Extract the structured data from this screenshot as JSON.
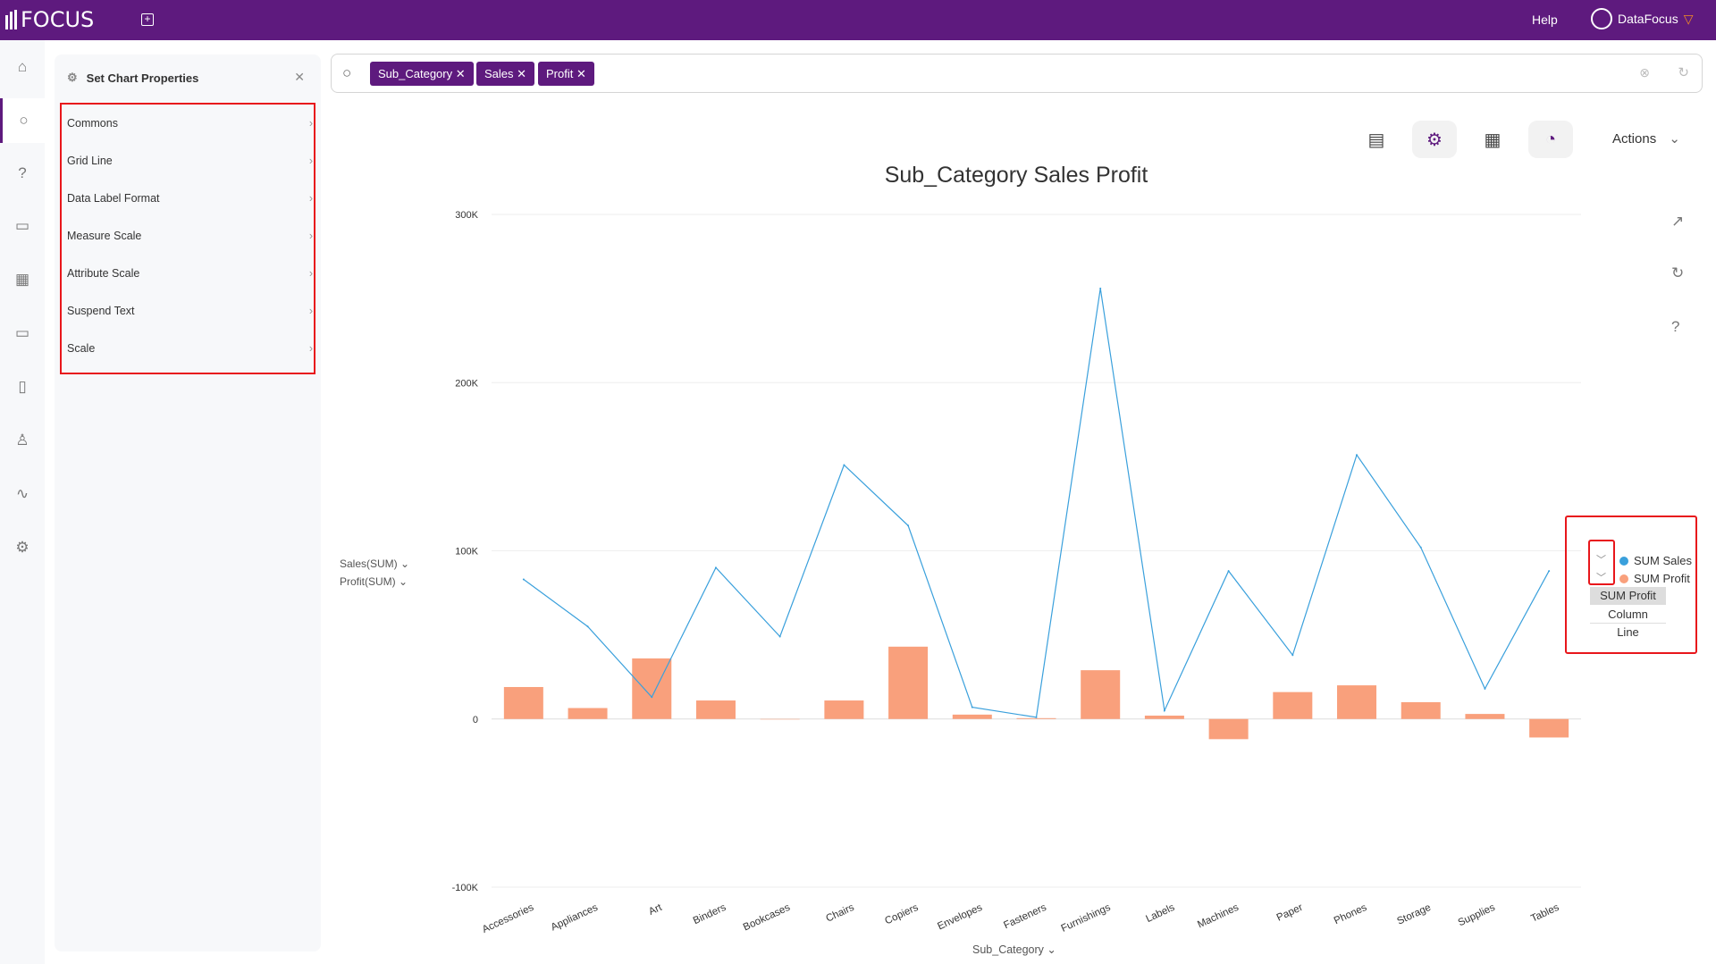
{
  "app": {
    "logo": "FOCUS",
    "help": "Help",
    "user": "DataFocus"
  },
  "nav": [
    "home",
    "search",
    "help",
    "presentation",
    "table",
    "folder",
    "clipboard",
    "user",
    "pulse",
    "settings"
  ],
  "panel": {
    "title": "Set Chart Properties",
    "items": [
      "Commons",
      "Grid Line",
      "Data Label Format",
      "Measure Scale",
      "Attribute Scale",
      "Suspend Text",
      "Scale"
    ]
  },
  "search": {
    "tags": [
      "Sub_Category",
      "Sales",
      "Profit"
    ]
  },
  "toolbar": {
    "actions": "Actions"
  },
  "colors": {
    "brand": "#5e1a7e",
    "sales": "#3aa0dc",
    "profit": "#f9a07c",
    "highlight": "#e8161b"
  },
  "left_legend": {
    "sales": "Sales(SUM)",
    "profit": "Profit(SUM)"
  },
  "legend": {
    "items": [
      "SUM Sales",
      "SUM Profit"
    ],
    "dropdown": {
      "selected": "SUM Profit",
      "options": [
        "Column",
        "Line"
      ]
    }
  },
  "chart_data": {
    "type": "bar+line",
    "title": "Sub_Category Sales Profit",
    "xlabel": "Sub_Category",
    "categories": [
      "Accessories",
      "Appliances",
      "Art",
      "Binders",
      "Bookcases",
      "Chairs",
      "Copiers",
      "Envelopes",
      "Fasteners",
      "Furnishings",
      "Labels",
      "Machines",
      "Paper",
      "Phones",
      "Storage",
      "Supplies",
      "Tables"
    ],
    "series": [
      {
        "name": "SUM Sales",
        "type": "line",
        "values": [
          83000,
          55000,
          13000,
          90000,
          49000,
          151000,
          115000,
          7000,
          1000,
          256000,
          5000,
          88000,
          38000,
          157000,
          102000,
          18000,
          88000
        ]
      },
      {
        "name": "SUM Profit",
        "type": "column",
        "values": [
          19000,
          6500,
          36000,
          11000,
          0,
          11000,
          43000,
          2600,
          500,
          29000,
          2000,
          -12000,
          16000,
          20000,
          10000,
          3000,
          -11000
        ]
      }
    ],
    "yticks": [
      "300K",
      "200K",
      "100K",
      "0",
      "-100K"
    ],
    "ylim": [
      -100000,
      300000
    ],
    "grid": true,
    "legend": "right"
  }
}
